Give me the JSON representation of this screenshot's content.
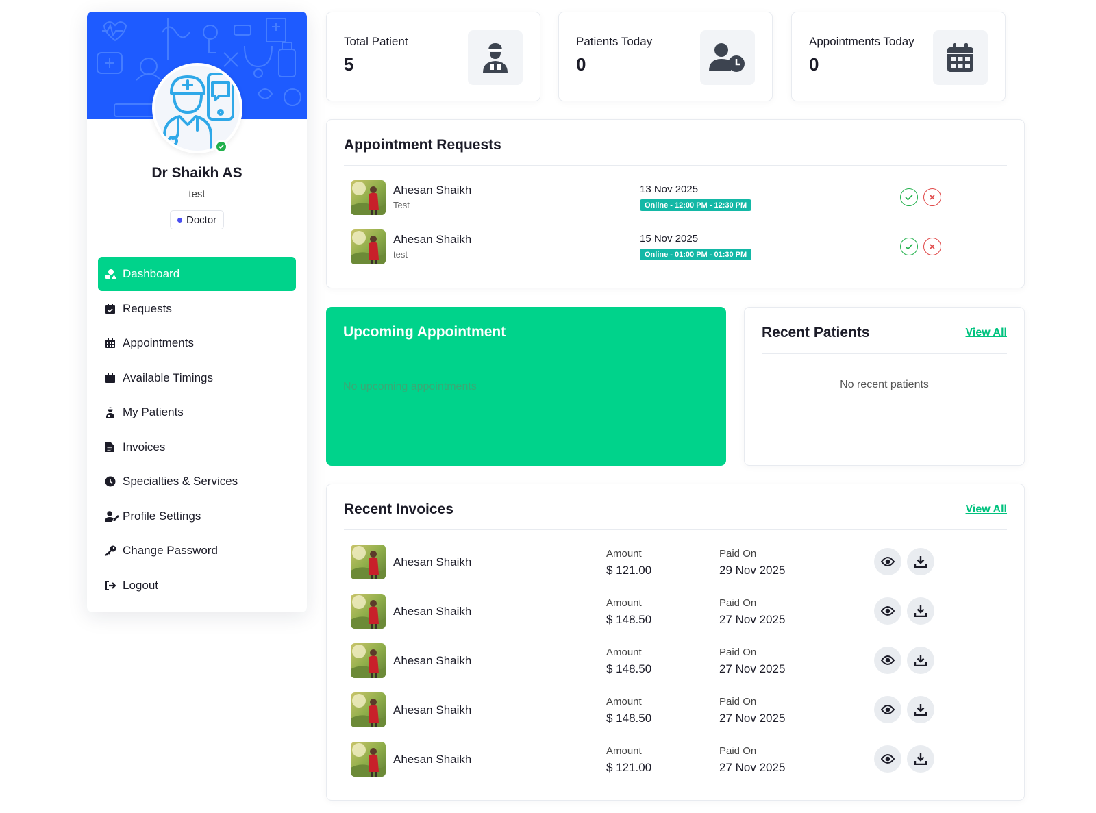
{
  "sidebar": {
    "doctor_name": "Dr Shaikh AS",
    "doctor_sub": "test",
    "role": "Doctor",
    "menu": [
      {
        "label": "Dashboard",
        "icon": "dashboard-icon",
        "active": true
      },
      {
        "label": "Requests",
        "icon": "calendar-check-icon"
      },
      {
        "label": "Appointments",
        "icon": "calendar-grid-icon"
      },
      {
        "label": "Available Timings",
        "icon": "calendar-icon"
      },
      {
        "label": "My Patients",
        "icon": "user-injured-icon"
      },
      {
        "label": "Invoices",
        "icon": "document-icon"
      },
      {
        "label": "Specialties & Services",
        "icon": "clock-icon"
      },
      {
        "label": "Profile Settings",
        "icon": "user-edit-icon"
      },
      {
        "label": "Change Password",
        "icon": "key-icon"
      },
      {
        "label": "Logout",
        "icon": "logout-icon"
      }
    ]
  },
  "stats": [
    {
      "label": "Total Patient",
      "value": "5",
      "icon": "patient-icon"
    },
    {
      "label": "Patients Today",
      "value": "0",
      "icon": "user-clock-icon"
    },
    {
      "label": "Appointments Today",
      "value": "0",
      "icon": "calendar-grid-icon"
    }
  ],
  "requests": {
    "title": "Appointment Requests",
    "items": [
      {
        "name": "Ahesan Shaikh",
        "note": "Test",
        "date": "13 Nov 2025",
        "slot": "Online - 12:00 PM - 12:30 PM"
      },
      {
        "name": "Ahesan Shaikh",
        "note": "test",
        "date": "15 Nov 2025",
        "slot": "Online - 01:00 PM - 01:30 PM"
      }
    ]
  },
  "upcoming": {
    "title": "Upcoming Appointment",
    "empty": "No upcoming appointments"
  },
  "recent_patients": {
    "title": "Recent Patients",
    "view_all": "View All",
    "empty": "No recent patients"
  },
  "invoices": {
    "title": "Recent Invoices",
    "view_all": "View All",
    "amount_label": "Amount",
    "paid_label": "Paid On",
    "items": [
      {
        "name": "Ahesan Shaikh",
        "amount": "$ 121.00",
        "paid_on": "29 Nov 2025"
      },
      {
        "name": "Ahesan Shaikh",
        "amount": "$ 148.50",
        "paid_on": "27 Nov 2025"
      },
      {
        "name": "Ahesan Shaikh",
        "amount": "$ 148.50",
        "paid_on": "27 Nov 2025"
      },
      {
        "name": "Ahesan Shaikh",
        "amount": "$ 148.50",
        "paid_on": "27 Nov 2025"
      },
      {
        "name": "Ahesan Shaikh",
        "amount": "$ 121.00",
        "paid_on": "27 Nov 2025"
      }
    ]
  },
  "colors": {
    "accent": "#00d38b",
    "banner": "#1e5bff",
    "approve": "#22b14c",
    "reject": "#e04848",
    "slot_badge": "#14b8a6"
  }
}
